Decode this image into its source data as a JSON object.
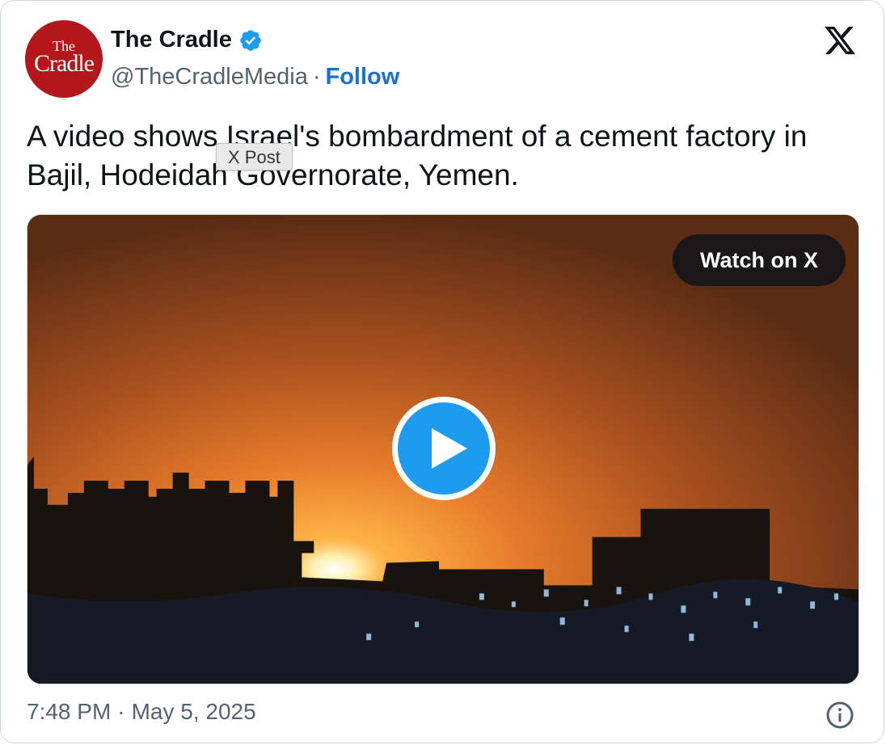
{
  "account": {
    "name": "The Cradle",
    "handle": "@TheCradleMedia",
    "separator": "·",
    "follow_label": "Follow",
    "avatar_top": "The",
    "avatar_main": "Cradle",
    "verified": true
  },
  "tweet": {
    "text": "A video shows Israel's bombardment of a cement factory in Bajil, Hodeidah Governorate, Yemen.",
    "tooltip": "X Post"
  },
  "media": {
    "watch_label": "Watch on X",
    "play_icon": "play-icon"
  },
  "footer": {
    "time": "7:48 PM",
    "separator": "·",
    "date": "May 5, 2025",
    "info_icon": "info-icon"
  },
  "colors": {
    "accent": "#1d9bf0",
    "follow": "#1d6fd8",
    "avatar_bg": "#b3171c",
    "muted": "#536471"
  }
}
